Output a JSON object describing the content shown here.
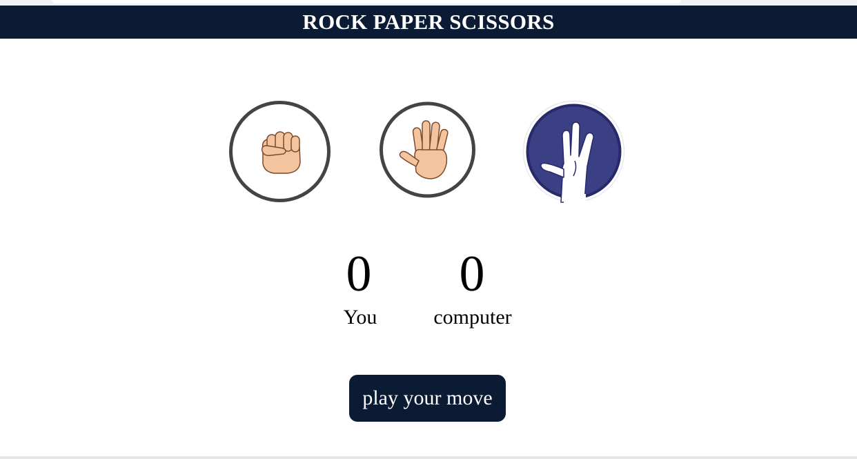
{
  "header": {
    "title": "ROCK PAPER SCISSORS"
  },
  "choices": [
    {
      "name": "rock",
      "icon": "fist-icon"
    },
    {
      "name": "paper",
      "icon": "open-hand-icon"
    },
    {
      "name": "spock",
      "icon": "vulcan-salute-icon"
    }
  ],
  "scores": {
    "you": {
      "value": "0",
      "label": "You"
    },
    "computer": {
      "value": "0",
      "label": "computer"
    }
  },
  "play_button": {
    "label": "play your move"
  },
  "colors": {
    "header_bg": "#0b1b33",
    "button_bg": "#0b1b33",
    "ring": "#444444",
    "skin": "#f3c49e",
    "spock_bg": "#3b3f83"
  }
}
